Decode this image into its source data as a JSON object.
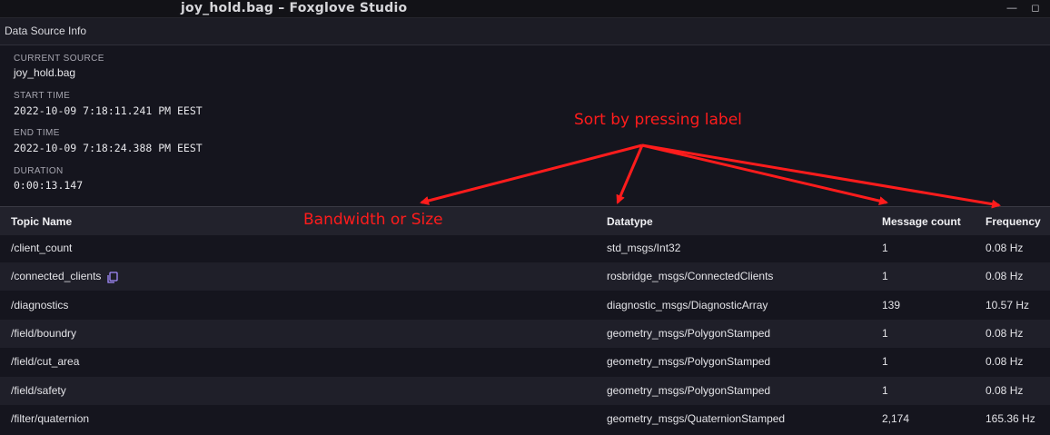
{
  "window": {
    "title": "joy_hold.bag – Foxglove Studio",
    "minimize_icon": "minimize-icon",
    "maximize_icon": "maximize-icon"
  },
  "panel": {
    "title": "Data Source Info"
  },
  "info": [
    {
      "label": "CURRENT SOURCE",
      "value": "joy_hold.bag",
      "mono": false
    },
    {
      "label": "START TIME",
      "value": "2022-10-09 7:18:11.241 PM EEST",
      "mono": true
    },
    {
      "label": "END TIME",
      "value": "2022-10-09 7:18:24.388 PM EEST",
      "mono": true
    },
    {
      "label": "DURATION",
      "value": "0:00:13.147",
      "mono": true
    }
  ],
  "table": {
    "columns": [
      "Topic Name",
      "Datatype",
      "Message count",
      "Frequency"
    ],
    "rows": [
      {
        "topic": "/client_count",
        "datatype": "std_msgs/Int32",
        "count": "1",
        "freq": "0.08 Hz",
        "copy": false
      },
      {
        "topic": "/connected_clients",
        "datatype": "rosbridge_msgs/ConnectedClients",
        "count": "1",
        "freq": "0.08 Hz",
        "copy": true
      },
      {
        "topic": "/diagnostics",
        "datatype": "diagnostic_msgs/DiagnosticArray",
        "count": "139",
        "freq": "10.57 Hz",
        "copy": false
      },
      {
        "topic": "/field/boundry",
        "datatype": "geometry_msgs/PolygonStamped",
        "count": "1",
        "freq": "0.08 Hz",
        "copy": false
      },
      {
        "topic": "/field/cut_area",
        "datatype": "geometry_msgs/PolygonStamped",
        "count": "1",
        "freq": "0.08 Hz",
        "copy": false
      },
      {
        "topic": "/field/safety",
        "datatype": "geometry_msgs/PolygonStamped",
        "count": "1",
        "freq": "0.08 Hz",
        "copy": false
      },
      {
        "topic": "/filter/quaternion",
        "datatype": "geometry_msgs/QuaternionStamped",
        "count": "2,174",
        "freq": "165.36 Hz",
        "copy": false
      }
    ]
  },
  "annotations": {
    "sort_hint": "Sort by pressing label",
    "bandwidth": "Bandwidth or Size",
    "color": "#ff1c1c"
  },
  "colors": {
    "background": "#15151e",
    "accent": "#a48cff"
  }
}
